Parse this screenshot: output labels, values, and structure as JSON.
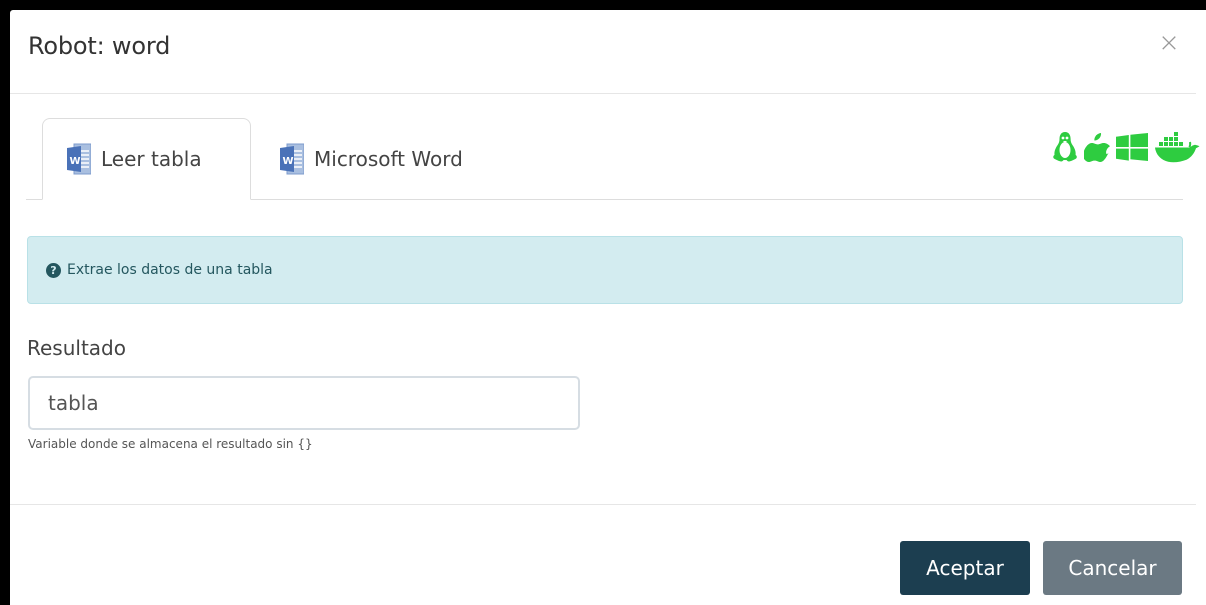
{
  "modal": {
    "title": "Robot: word",
    "close_glyph": "×"
  },
  "tabs": [
    {
      "label": "Leer tabla",
      "icon": "word-icon",
      "active": true
    },
    {
      "label": "Microsoft Word",
      "icon": "word-icon",
      "active": false
    }
  ],
  "platform_icons": {
    "items": [
      "linux-icon",
      "apple-icon",
      "windows-icon",
      "docker-icon"
    ],
    "color": "#2ecc40"
  },
  "info_alert": {
    "icon": "question-circle-icon",
    "text": "Extrae los datos de una tabla"
  },
  "form": {
    "result_label": "Resultado",
    "result_value": "tabla",
    "result_help": "Variable donde se almacena el resultado sin {}"
  },
  "footer": {
    "accept_label": "Aceptar",
    "cancel_label": "Cancelar"
  },
  "colors": {
    "accept_button": "#1c3e50",
    "cancel_button": "#6b7983",
    "alert_background": "#d3ecf0",
    "word_blue": "#4a72b8"
  }
}
